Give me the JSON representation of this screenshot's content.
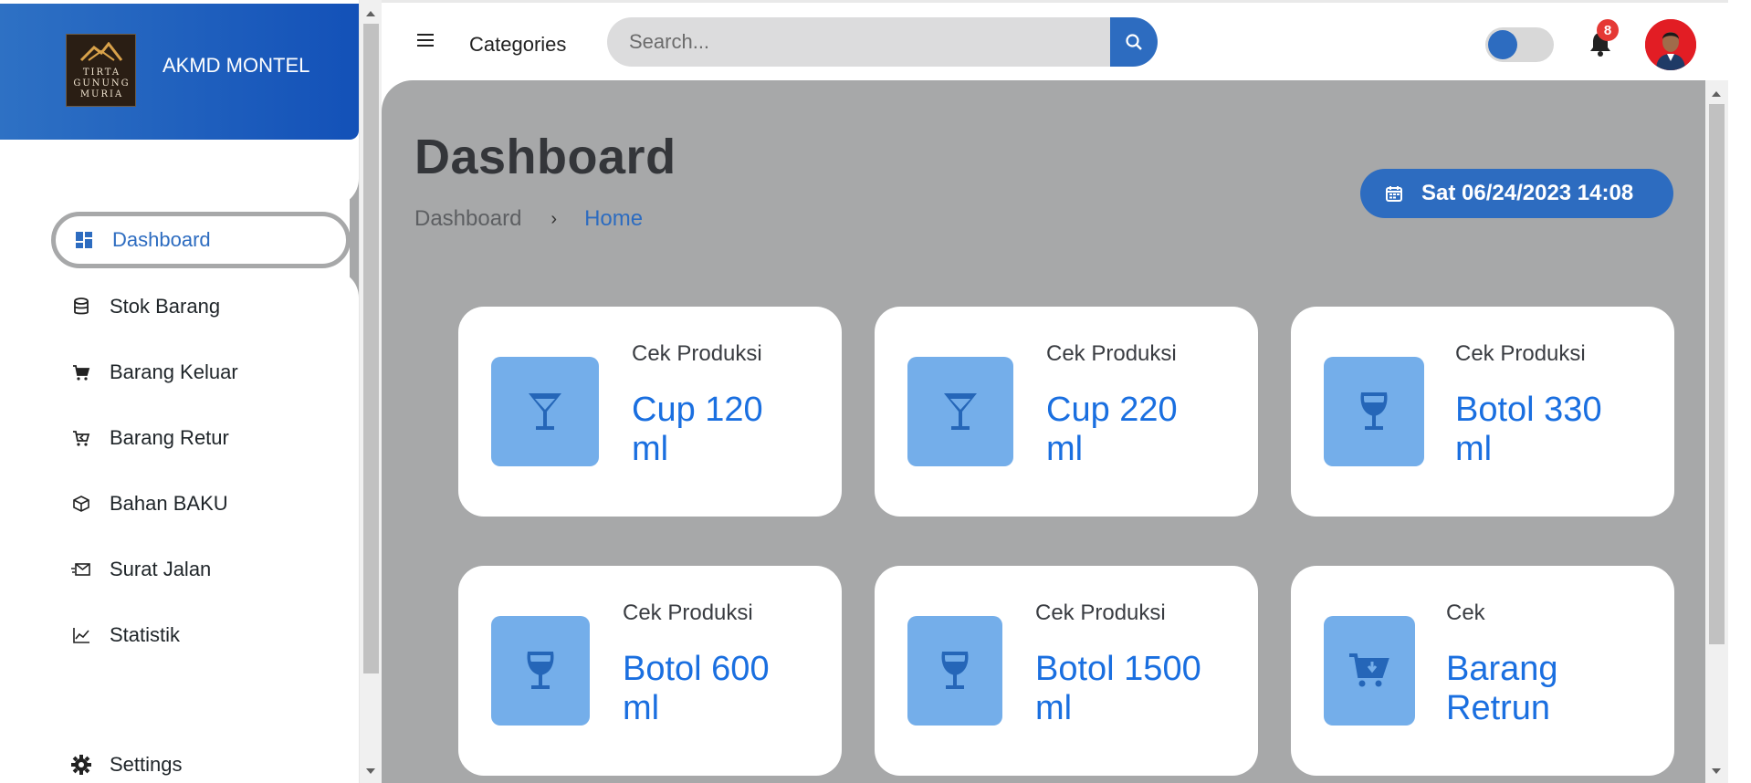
{
  "brand": {
    "name": "AKMD MONTEL",
    "logo_text": [
      "TIRTA",
      "GUNUNG",
      "MURIA"
    ]
  },
  "sidebar": {
    "items": [
      {
        "label": "Dashboard",
        "icon": "dashboard-icon",
        "active": true
      },
      {
        "label": "Stok Barang",
        "icon": "database-icon"
      },
      {
        "label": "Barang Keluar",
        "icon": "cart-icon"
      },
      {
        "label": "Barang Retur",
        "icon": "cart-return-icon"
      },
      {
        "label": "Bahan BAKU",
        "icon": "box-icon"
      },
      {
        "label": "Surat Jalan",
        "icon": "mail-send-icon"
      },
      {
        "label": "Statistik",
        "icon": "line-chart-icon"
      }
    ],
    "settings_label": "Settings"
  },
  "header": {
    "categories_label": "Categories",
    "search_placeholder": "Search...",
    "notification_count": "8"
  },
  "main": {
    "title": "Dashboard",
    "breadcrumb": {
      "root": "Dashboard",
      "current": "Home"
    },
    "datetime": "Sat 06/24/2023 14:08",
    "cards": [
      {
        "label": "Cek Produksi",
        "value_line1": "Cup 120",
        "value_line2": "ml",
        "icon": "cocktail-glass-icon"
      },
      {
        "label": "Cek Produksi",
        "value_line1": "Cup 220",
        "value_line2": "ml",
        "icon": "cocktail-glass-icon"
      },
      {
        "label": "Cek Produksi",
        "value_line1": "Botol 330",
        "value_line2": "ml",
        "icon": "wine-glass-icon"
      },
      {
        "label": "Cek Produksi",
        "value_line1": "Botol 600",
        "value_line2": "ml",
        "icon": "wine-glass-icon"
      },
      {
        "label": "Cek Produksi",
        "value_line1": "Botol 1500",
        "value_line2": "ml",
        "icon": "wine-glass-icon"
      },
      {
        "label": "Cek",
        "value_line1": "Barang",
        "value_line2": "Retrun",
        "icon": "cart-download-icon"
      }
    ]
  },
  "colors": {
    "primary": "#2d6cc0",
    "accent_text": "#1a6fe0",
    "icon_box": "#74aeea",
    "content_bg": "#a7a8a9",
    "badge": "#e53935"
  }
}
